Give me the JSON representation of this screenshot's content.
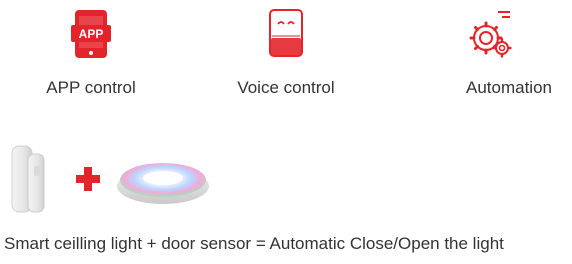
{
  "features": [
    {
      "label": "APP control",
      "icon": "app-phone-icon",
      "icon_text": "APP"
    },
    {
      "label": "Voice control",
      "icon": "smart-speaker-icon"
    },
    {
      "label": "Automation",
      "icon": "automation-gears-icon"
    }
  ],
  "combo": {
    "items": [
      "door-sensor-image",
      "plus-icon",
      "ceiling-light-image"
    ]
  },
  "caption": "Smart ceilling light + door sensor = Automatic Close/Open the light",
  "colors": {
    "accent": "#e3252b",
    "text": "#333333",
    "background": "#ffffff"
  }
}
